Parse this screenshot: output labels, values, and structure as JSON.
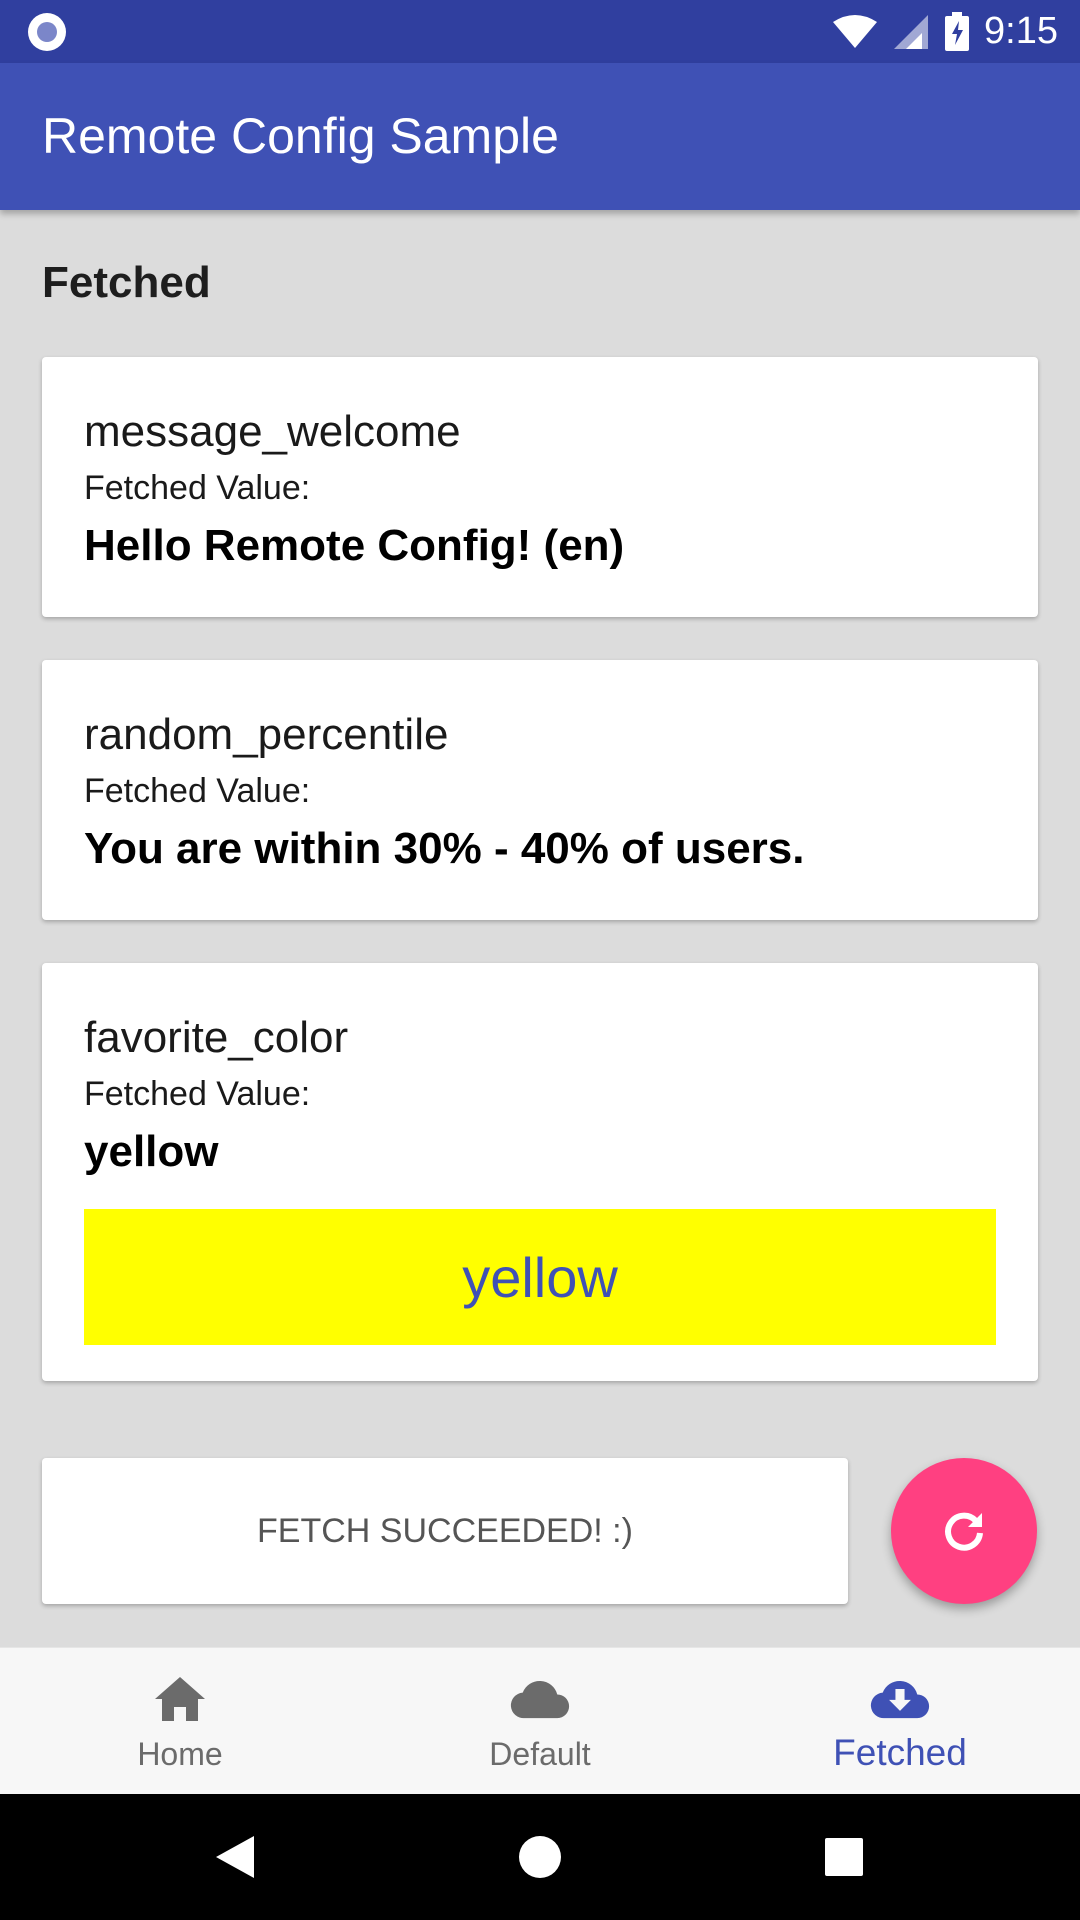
{
  "status_bar": {
    "time": "9:15"
  },
  "app": {
    "title": "Remote Config Sample"
  },
  "section": {
    "title": "Fetched"
  },
  "cards": [
    {
      "key": "message_welcome",
      "label": "Fetched Value:",
      "value": "Hello Remote Config! (en)"
    },
    {
      "key": "random_percentile",
      "label": "Fetched Value:",
      "value": "You are within 30% - 40% of users."
    },
    {
      "key": "favorite_color",
      "label": "Fetched Value:",
      "value": "yellow",
      "swatch_text": "yellow",
      "swatch_color": "#ffff00"
    }
  ],
  "fetch_status": {
    "text": "FETCH SUCCEEDED! :)"
  },
  "fab": {
    "icon": "refresh-icon",
    "color": "#ff4081"
  },
  "bottom_nav": {
    "items": [
      {
        "label": "Home",
        "icon": "home-icon",
        "active": false
      },
      {
        "label": "Default",
        "icon": "cloud-icon",
        "active": false
      },
      {
        "label": "Fetched",
        "icon": "cloud-download-icon",
        "active": true
      }
    ],
    "active_color": "#3f51b5",
    "inactive_color": "#6b6b6b"
  },
  "system_nav": {
    "icons": [
      "back-icon",
      "home-circle-icon",
      "recents-icon"
    ]
  }
}
